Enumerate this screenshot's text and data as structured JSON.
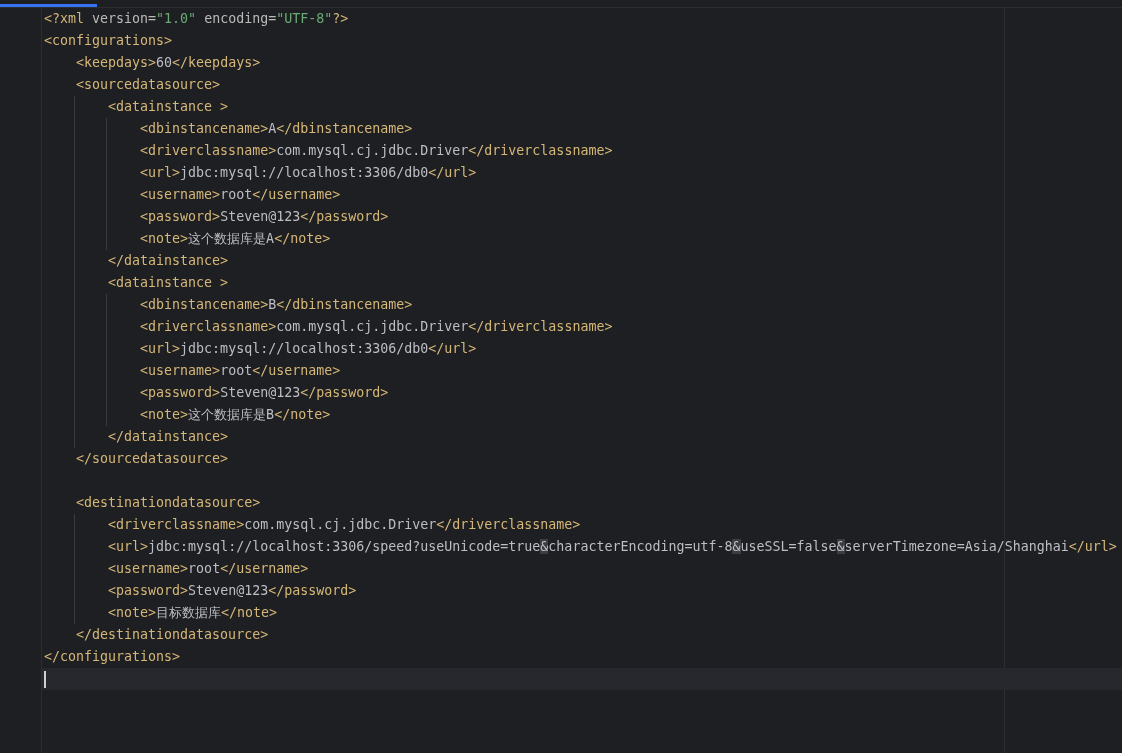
{
  "editor": {
    "active_tab_indicator": true,
    "lines": [
      {
        "tokens": [
          {
            "kind": "tag",
            "text": "<?xml "
          },
          {
            "kind": "attr",
            "text": "version="
          },
          {
            "kind": "string",
            "text": "\"1.0\""
          },
          {
            "kind": "attr",
            "text": " encoding="
          },
          {
            "kind": "string",
            "text": "\"UTF-8\""
          },
          {
            "kind": "tag",
            "text": "?>"
          }
        ]
      },
      {
        "tokens": [
          {
            "kind": "tag",
            "text": "<configurations>"
          }
        ]
      },
      {
        "tokens": [
          {
            "kind": "tag",
            "text": "    <keepdays>"
          },
          {
            "kind": "text",
            "text": "60"
          },
          {
            "kind": "tag",
            "text": "</keepdays>"
          }
        ]
      },
      {
        "tokens": [
          {
            "kind": "tag",
            "text": "    <sourcedatasource>"
          }
        ]
      },
      {
        "tokens": [
          {
            "kind": "tag",
            "text": "        <datainstance >"
          }
        ]
      },
      {
        "tokens": [
          {
            "kind": "tag",
            "text": "            <dbinstancename>"
          },
          {
            "kind": "text",
            "text": "A"
          },
          {
            "kind": "tag",
            "text": "</dbinstancename>"
          }
        ]
      },
      {
        "tokens": [
          {
            "kind": "tag",
            "text": "            <driverclassname>"
          },
          {
            "kind": "text",
            "text": "com.mysql.cj.jdbc.Driver"
          },
          {
            "kind": "tag",
            "text": "</driverclassname>"
          }
        ]
      },
      {
        "tokens": [
          {
            "kind": "tag",
            "text": "            <url>"
          },
          {
            "kind": "text",
            "text": "jdbc:mysql://localhost:3306/db0"
          },
          {
            "kind": "tag",
            "text": "</url>"
          }
        ]
      },
      {
        "tokens": [
          {
            "kind": "tag",
            "text": "            <username>"
          },
          {
            "kind": "text",
            "text": "root"
          },
          {
            "kind": "tag",
            "text": "</username>"
          }
        ]
      },
      {
        "tokens": [
          {
            "kind": "tag",
            "text": "            <password>"
          },
          {
            "kind": "text",
            "text": "Steven@123"
          },
          {
            "kind": "tag",
            "text": "</password>"
          }
        ]
      },
      {
        "tokens": [
          {
            "kind": "tag",
            "text": "            <note>"
          },
          {
            "kind": "text",
            "text": "这个数据库是A"
          },
          {
            "kind": "tag",
            "text": "</note>"
          }
        ]
      },
      {
        "tokens": [
          {
            "kind": "tag",
            "text": "        </datainstance>"
          }
        ]
      },
      {
        "tokens": [
          {
            "kind": "tag",
            "text": "        <datainstance >"
          }
        ]
      },
      {
        "tokens": [
          {
            "kind": "tag",
            "text": "            <dbinstancename>"
          },
          {
            "kind": "text",
            "text": "B"
          },
          {
            "kind": "tag",
            "text": "</dbinstancename>"
          }
        ]
      },
      {
        "tokens": [
          {
            "kind": "tag",
            "text": "            <driverclassname>"
          },
          {
            "kind": "text",
            "text": "com.mysql.cj.jdbc.Driver"
          },
          {
            "kind": "tag",
            "text": "</driverclassname>"
          }
        ]
      },
      {
        "tokens": [
          {
            "kind": "tag",
            "text": "            <url>"
          },
          {
            "kind": "text",
            "text": "jdbc:mysql://localhost:3306/db0"
          },
          {
            "kind": "tag",
            "text": "</url>"
          }
        ]
      },
      {
        "tokens": [
          {
            "kind": "tag",
            "text": "            <username>"
          },
          {
            "kind": "text",
            "text": "root"
          },
          {
            "kind": "tag",
            "text": "</username>"
          }
        ]
      },
      {
        "tokens": [
          {
            "kind": "tag",
            "text": "            <password>"
          },
          {
            "kind": "text",
            "text": "Steven@123"
          },
          {
            "kind": "tag",
            "text": "</password>"
          }
        ]
      },
      {
        "tokens": [
          {
            "kind": "tag",
            "text": "            <note>"
          },
          {
            "kind": "text",
            "text": "这个数据库是B"
          },
          {
            "kind": "tag",
            "text": "</note>"
          }
        ]
      },
      {
        "tokens": [
          {
            "kind": "tag",
            "text": "        </datainstance>"
          }
        ]
      },
      {
        "tokens": [
          {
            "kind": "tag",
            "text": "    </sourcedatasource>"
          }
        ]
      },
      {
        "blank_line_before": true,
        "tokens": [
          {
            "kind": "tag",
            "text": "    <destinationdatasource>"
          }
        ]
      },
      {
        "tokens": [
          {
            "kind": "tag",
            "text": "        <driverclassname>"
          },
          {
            "kind": "text",
            "text": "com.mysql.cj.jdbc.Driver"
          },
          {
            "kind": "tag",
            "text": "</driverclassname>"
          }
        ]
      },
      {
        "tokens": [
          {
            "kind": "tag",
            "text": "        <url>"
          },
          {
            "kind": "text",
            "text": "jdbc:mysql://localhost:3306/speed?useUnicode=true"
          },
          {
            "kind": "entity",
            "text": "&"
          },
          {
            "kind": "text",
            "text": "characterEncoding=utf-8"
          },
          {
            "kind": "entity",
            "text": "&"
          },
          {
            "kind": "text",
            "text": "useSSL=false"
          },
          {
            "kind": "entity",
            "text": "&"
          },
          {
            "kind": "text",
            "text": "serverTimezone=Asia/Shanghai"
          },
          {
            "kind": "tag",
            "text": "</url>"
          }
        ]
      },
      {
        "tokens": [
          {
            "kind": "tag",
            "text": "        <username>"
          },
          {
            "kind": "text",
            "text": "root"
          },
          {
            "kind": "tag",
            "text": "</username>"
          }
        ]
      },
      {
        "tokens": [
          {
            "kind": "tag",
            "text": "        <password>"
          },
          {
            "kind": "text",
            "text": "Steven@123"
          },
          {
            "kind": "tag",
            "text": "</password>"
          }
        ]
      },
      {
        "tokens": [
          {
            "kind": "tag",
            "text": "        <note>"
          },
          {
            "kind": "text",
            "text": "目标数据库"
          },
          {
            "kind": "tag",
            "text": "</note>"
          }
        ]
      },
      {
        "tokens": [
          {
            "kind": "tag",
            "text": "    </destinationdatasource>"
          }
        ]
      },
      {
        "tokens": [
          {
            "kind": "tag",
            "text": "</configurations>"
          }
        ]
      }
    ],
    "cursor_line": {
      "caret": true
    }
  }
}
